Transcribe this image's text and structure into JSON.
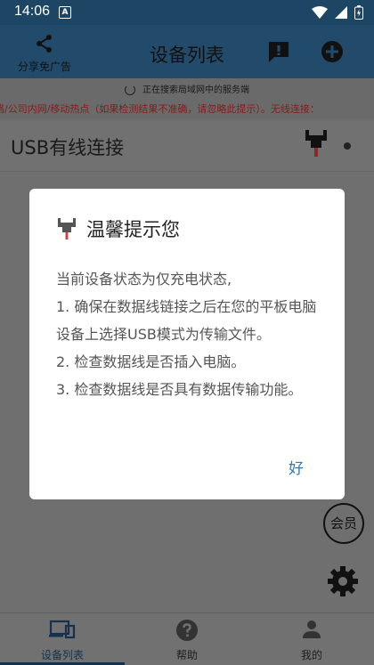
{
  "status_bar": {
    "time": "14:06",
    "notification_badge": "A"
  },
  "app_bar": {
    "share_label": "分享免广告",
    "title": "设备列表"
  },
  "banner": {
    "searching": "正在搜索局域网中的服务端",
    "hint": "络/公司内网/移动热点（如果检测结果不准确，请忽略此提示）。无线连接："
  },
  "usb_card": {
    "label": "USB有线连接"
  },
  "dialog": {
    "title": "温馨提示您",
    "lines": [
      "当前设备状态为仅充电状态,",
      " 1. 确保在数据线链接之后在您的平板电脑设备上选择USB模式为传输文件。",
      " 2. 检查数据线是否插入电脑。",
      " 3. 检查数据线是否具有数据传输功能。"
    ],
    "ok_label": "好"
  },
  "member_label": "会员",
  "bottom_nav": {
    "items": [
      {
        "label": "设备列表",
        "icon": "devices-icon",
        "active": true
      },
      {
        "label": "帮助",
        "icon": "help-icon",
        "active": false
      },
      {
        "label": "我的",
        "icon": "person-icon",
        "active": false
      }
    ]
  },
  "colors": {
    "accent": "#2a7bc4",
    "primary": "#14324e",
    "hint_red": "#8a1a1a"
  }
}
